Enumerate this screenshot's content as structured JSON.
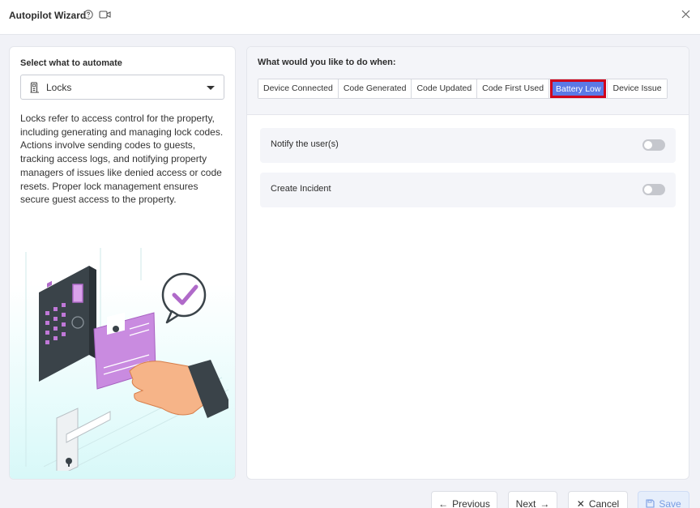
{
  "window": {
    "title": "Autopilot Wizard"
  },
  "left": {
    "select_label": "Select what to automate",
    "selected_value": "Locks",
    "description": "Locks refer to access control for the property, including generating and managing lock codes. Actions involve sending codes to guests, tracking access logs, and notifying property managers of issues like denied access or code resets. Proper lock management ensures secure guest access to the property."
  },
  "right": {
    "question": "What would you like to do when:",
    "tabs": [
      {
        "label": "Device Connected"
      },
      {
        "label": "Code Generated"
      },
      {
        "label": "Code Updated"
      },
      {
        "label": "Code First Used"
      },
      {
        "label": "Battery Low",
        "active": true
      },
      {
        "label": "Device Issue"
      }
    ],
    "options": [
      {
        "label": "Notify the user(s)",
        "enabled": false
      },
      {
        "label": "Create Incident",
        "enabled": false
      }
    ]
  },
  "footer": {
    "previous_label": "Previous",
    "next_label": "Next",
    "cancel_label": "Cancel",
    "save_label": "Save"
  },
  "colors": {
    "active_tab": "#5b79e6",
    "highlight_border": "#d0021b",
    "accent_purple": "#b06ac9",
    "save_button": "#7a9de3"
  }
}
